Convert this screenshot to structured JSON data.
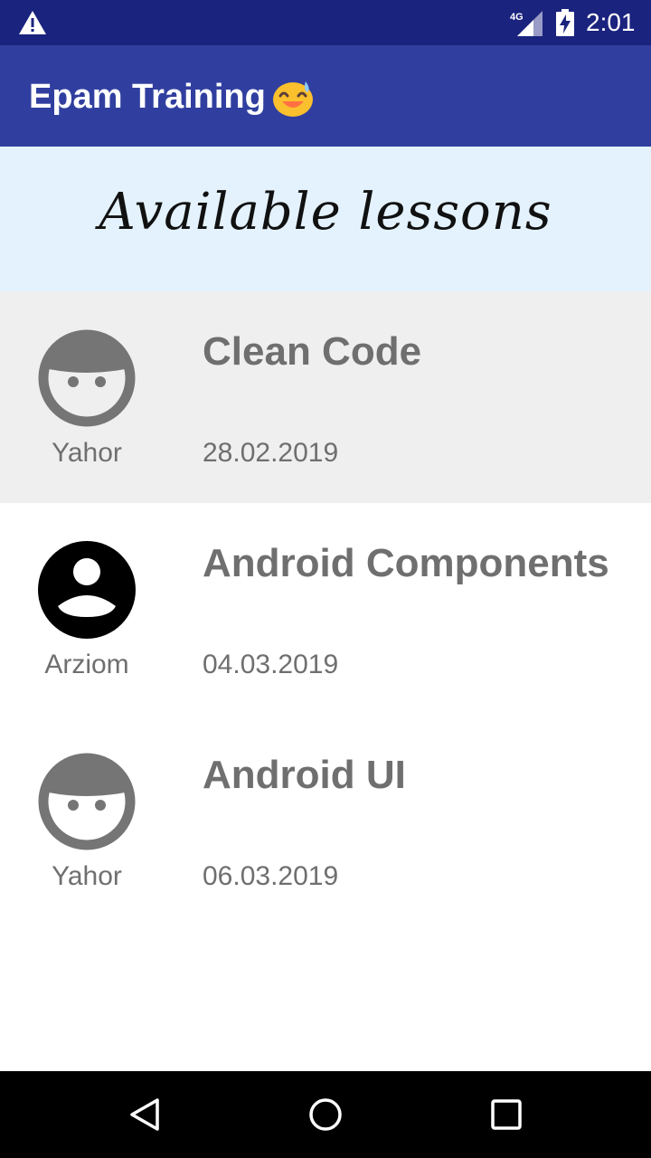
{
  "status_bar": {
    "time": "2:01",
    "network": "4G",
    "icons": [
      "warning-icon",
      "signal-icon",
      "battery-charging-icon"
    ]
  },
  "app_bar": {
    "title": "Epam Training",
    "emoji": "grinning-sweat-emoji",
    "color": "#303f9f"
  },
  "banner": {
    "heading": "Available lessons",
    "background": "#e3f2fd"
  },
  "lessons": [
    {
      "title": "Clean Code",
      "author": "Yahor",
      "date": "28.02.2019",
      "avatar": "boy-face-icon",
      "selected": true
    },
    {
      "title": "Android Components",
      "author": "Arziom",
      "date": "04.03.2019",
      "avatar": "account-circle-icon",
      "selected": false
    },
    {
      "title": "Android UI",
      "author": "Yahor",
      "date": "06.03.2019",
      "avatar": "boy-face-icon",
      "selected": false
    }
  ],
  "nav_bar": {
    "buttons": [
      "back-icon",
      "home-icon",
      "recents-icon"
    ]
  }
}
